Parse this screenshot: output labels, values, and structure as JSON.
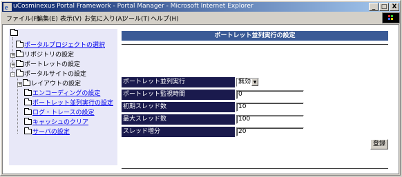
{
  "window": {
    "title": "uCosminexus Portal Framework - Portal Manager - Microsoft Internet Explorer",
    "minimize": "_",
    "maximize": "□",
    "close": "X"
  },
  "menu": {
    "items": [
      "ファイル(F)",
      "編集(E)",
      "表示(V)",
      "お気に入り(A)",
      "ツール(T)",
      "ヘルプ(H)"
    ]
  },
  "sidebar": {
    "items": [
      {
        "label": "ポータルプロジェクトの選択"
      },
      {
        "label": "リポジトリの設定",
        "toggle": "+"
      },
      {
        "label": "ポートレットの設定",
        "toggle": "+"
      },
      {
        "label": "ポータルサイトの設定",
        "toggle": "-"
      },
      {
        "label": "レイアウトの設定",
        "toggle": "+"
      },
      {
        "label": "エンコーディングの設定"
      },
      {
        "label": "ポートレット並列実行の設定"
      },
      {
        "label": "ログ・トレースの設定"
      },
      {
        "label": "キャッシュのクリア"
      },
      {
        "label": "サーバの設定"
      }
    ]
  },
  "main": {
    "header": "ポートレット並列実行の設定",
    "fields": [
      {
        "label": "ポートレット並列実行",
        "value": "無効"
      },
      {
        "label": "ポートレット監視時間",
        "value": "0"
      },
      {
        "label": "初期スレッド数",
        "value": "10"
      },
      {
        "label": "最大スレッド数",
        "value": "100"
      },
      {
        "label": "スレッド増分",
        "value": "20"
      }
    ],
    "submit_label": "登録"
  }
}
